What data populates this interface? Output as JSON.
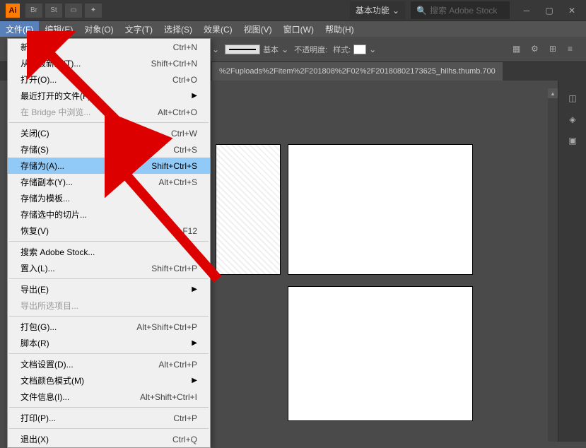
{
  "titlebar": {
    "logo": "Ai",
    "btns": [
      "Br",
      "St"
    ],
    "workspace": "基本功能",
    "search_placeholder": "搜索 Adobe Stock"
  },
  "menubar": {
    "items": [
      "文件(F)",
      "编辑(E)",
      "对象(O)",
      "文字(T)",
      "选择(S)",
      "效果(C)",
      "视图(V)",
      "窗口(W)",
      "帮助(H)"
    ]
  },
  "toolbar": {
    "style_label": "基本",
    "opacity_label": "不透明度:",
    "graphic_style_label": "样式:"
  },
  "doc_tab": "%2Fuploads%2Fitem%2F201808%2F02%2F20180802173625_hilhs.thumb.700",
  "file_menu": {
    "groups": [
      [
        {
          "label": "新建(N)...",
          "shortcut": "Ctrl+N"
        },
        {
          "label": "从模板新建(T)...",
          "shortcut": "Shift+Ctrl+N"
        },
        {
          "label": "打开(O)...",
          "shortcut": "Ctrl+O"
        },
        {
          "label": "最近打开的文件(F)",
          "submenu": true
        },
        {
          "label": "在 Bridge 中浏览...",
          "shortcut": "Alt+Ctrl+O",
          "disabled": true
        }
      ],
      [
        {
          "label": "关闭(C)",
          "shortcut": "Ctrl+W"
        },
        {
          "label": "存储(S)",
          "shortcut": "Ctrl+S"
        },
        {
          "label": "存储为(A)...",
          "shortcut": "Shift+Ctrl+S",
          "highlighted": true
        },
        {
          "label": "存储副本(Y)...",
          "shortcut": "Alt+Ctrl+S"
        },
        {
          "label": "存储为模板..."
        },
        {
          "label": "存储选中的切片..."
        },
        {
          "label": "恢复(V)",
          "shortcut": "F12"
        }
      ],
      [
        {
          "label": "搜索 Adobe Stock..."
        },
        {
          "label": "置入(L)...",
          "shortcut": "Shift+Ctrl+P"
        }
      ],
      [
        {
          "label": "导出(E)",
          "submenu": true
        },
        {
          "label": "导出所选项目...",
          "disabled": true
        }
      ],
      [
        {
          "label": "打包(G)...",
          "shortcut": "Alt+Shift+Ctrl+P"
        },
        {
          "label": "脚本(R)",
          "submenu": true
        }
      ],
      [
        {
          "label": "文档设置(D)...",
          "shortcut": "Alt+Ctrl+P"
        },
        {
          "label": "文档颜色模式(M)",
          "submenu": true
        },
        {
          "label": "文件信息(I)...",
          "shortcut": "Alt+Shift+Ctrl+I"
        }
      ],
      [
        {
          "label": "打印(P)...",
          "shortcut": "Ctrl+P"
        }
      ],
      [
        {
          "label": "退出(X)",
          "shortcut": "Ctrl+Q"
        }
      ]
    ]
  }
}
